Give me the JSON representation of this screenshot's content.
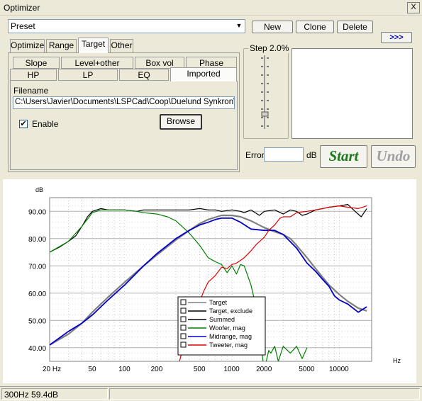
{
  "window": {
    "title": "Optimizer",
    "close_label": "X"
  },
  "toolbar": {
    "preset_value": "Preset",
    "new_label": "New",
    "clone_label": "Clone",
    "delete_label": "Delete",
    "more_label": ">>>"
  },
  "tabs": [
    {
      "label": "Optimize",
      "active": false
    },
    {
      "label": "Range",
      "active": false
    },
    {
      "label": "Target",
      "active": true
    },
    {
      "label": "Other",
      "active": false
    }
  ],
  "subtabs_row1": [
    "Slope",
    "Level+other",
    "Box vol",
    "Phase"
  ],
  "subtabs_row2": [
    "HP",
    "LP",
    "EQ",
    "Imported"
  ],
  "target_panel": {
    "filename_label": "Filename",
    "filename_value": "C:\\Users\\Javier\\Documents\\LSPCad\\Coop\\Duelund Synkron\\A",
    "enable_label": "Enable",
    "enable_checked": true,
    "browse_label": "Browse"
  },
  "step": {
    "label": "Step 2.0%"
  },
  "error": {
    "label": "Error",
    "unit": "dB",
    "value": ""
  },
  "actions": {
    "start_label": "Start",
    "undo_label": "Undo"
  },
  "status": {
    "readout": "300Hz 59.4dB",
    "second": ""
  },
  "colors": {
    "target": "#808080",
    "target_exclude": "#000000",
    "summed": "#000000",
    "woofer": "#008000",
    "midrange": "#0000c8",
    "tweeter": "#e00000",
    "start": "#1a7a1a",
    "undo": "#a0a0a0"
  },
  "chart_data": {
    "type": "line",
    "ylabel": "dB",
    "xlabel": "Hz",
    "xscale": "log",
    "xlim": [
      20,
      20000
    ],
    "ylim": [
      35,
      95
    ],
    "xticks": [
      {
        "v": 20,
        "label": "20 Hz"
      },
      {
        "v": 50,
        "label": "50"
      },
      {
        "v": 100,
        "label": "100"
      },
      {
        "v": 200,
        "label": "200"
      },
      {
        "v": 500,
        "label": "500"
      },
      {
        "v": 1000,
        "label": "1000"
      },
      {
        "v": 2000,
        "label": "2000"
      },
      {
        "v": 5000,
        "label": "5000"
      },
      {
        "v": 10000,
        "label": "10000"
      }
    ],
    "yticks": [
      {
        "v": 90,
        "label": "90.00"
      },
      {
        "v": 80,
        "label": "80.00"
      },
      {
        "v": 70,
        "label": "70.00"
      },
      {
        "v": 60,
        "label": "60.00"
      },
      {
        "v": 50,
        "label": "50.00"
      },
      {
        "v": 40,
        "label": "40.00"
      }
    ],
    "grid": true,
    "legend_position": "bottom-center",
    "series": [
      {
        "name": "Target",
        "color": "#808080",
        "width": 2.2,
        "x": [
          20,
          30,
          40,
          50,
          70,
          100,
          150,
          200,
          300,
          400,
          500,
          600,
          800,
          1000,
          1200,
          1500,
          2000,
          2500,
          3000,
          3500,
          4000,
          5000,
          6000,
          8000,
          10000,
          12000,
          15000,
          18000
        ],
        "y": [
          41,
          45,
          49,
          53,
          58.5,
          64,
          70,
          74,
          79.5,
          83,
          85.5,
          87,
          88.5,
          88.5,
          88,
          86.5,
          84,
          82.5,
          81.5,
          80,
          77.5,
          73,
          69,
          63,
          59.5,
          57,
          54.5,
          53.5
        ]
      },
      {
        "name": "Target, exclude",
        "color": "#000000",
        "width": 1.2,
        "x": [],
        "y": []
      },
      {
        "name": "Summed",
        "color": "#000000",
        "width": 1.2,
        "x": [
          20,
          25,
          30,
          35,
          40,
          45,
          50,
          60,
          70,
          80,
          100,
          130,
          150,
          200,
          250,
          300,
          400,
          500,
          600,
          700,
          800,
          1000,
          1200,
          1300,
          1500,
          1800,
          2000,
          2500,
          3000,
          3500,
          4000,
          4500,
          5000,
          6000,
          7000,
          8000,
          10000,
          12000,
          14000,
          16000,
          18000
        ],
        "y": [
          75,
          77,
          79,
          81,
          84.5,
          88,
          90,
          91,
          90.5,
          90.5,
          90.5,
          90,
          90.5,
          90.5,
          90.5,
          90.5,
          90.5,
          91,
          90.5,
          90.5,
          90,
          90.5,
          90,
          89.5,
          90.5,
          88.5,
          90,
          90.5,
          89,
          90.5,
          90,
          88.5,
          89,
          90.5,
          91,
          91.5,
          92,
          92.5,
          90,
          88,
          91
        ]
      },
      {
        "name": "Woofer, mag",
        "color": "#008000",
        "width": 1.2,
        "x": [
          20,
          30,
          40,
          50,
          60,
          70,
          100,
          130,
          150,
          200,
          250,
          300,
          400,
          500,
          600,
          700,
          800,
          900,
          1000,
          1100,
          1200,
          1300,
          1500,
          1700,
          1800,
          1900,
          2000,
          2200,
          2300,
          2500,
          2700,
          3000,
          3500,
          4000,
          4500,
          5000
        ],
        "y": [
          75,
          79,
          84.5,
          89.5,
          90.5,
          90.5,
          90.5,
          90,
          89.5,
          89,
          88,
          86.5,
          82,
          77.5,
          73,
          71.5,
          70.5,
          67.5,
          70,
          67,
          70.5,
          70,
          63,
          54,
          45.5,
          38,
          32,
          39,
          38,
          40.5,
          35,
          40.5,
          38,
          40.5,
          36,
          40
        ]
      },
      {
        "name": "Midrange, mag",
        "color": "#0000c8",
        "width": 1.8,
        "x": [
          20,
          30,
          40,
          50,
          70,
          100,
          150,
          200,
          300,
          400,
          500,
          600,
          700,
          800,
          1000,
          1200,
          1500,
          2000,
          2500,
          3000,
          4000,
          5000,
          6000,
          7000,
          8000,
          9000,
          10000,
          12000,
          15000,
          18000
        ],
        "y": [
          41,
          46,
          49,
          52,
          57.5,
          63,
          70,
          74.5,
          80,
          83,
          85,
          86,
          87,
          87.5,
          87.5,
          86,
          83.5,
          83,
          83,
          81.5,
          76.5,
          71,
          68,
          65,
          62.5,
          59,
          57.5,
          56,
          53,
          55
        ]
      },
      {
        "name": "Tweeter, mag",
        "color": "#e00000",
        "width": 1.2,
        "x": [
          300,
          350,
          400,
          450,
          500,
          550,
          600,
          700,
          800,
          900,
          1000,
          1100,
          1200,
          1300,
          1500,
          1700,
          2000,
          2200,
          2500,
          2800,
          3000,
          3500,
          4000,
          5000,
          6000,
          7000,
          8000,
          10000,
          12000,
          15000,
          18000
        ],
        "y": [
          30,
          40,
          45.5,
          52.5,
          57,
          61,
          64,
          66.5,
          69.5,
          69,
          70.5,
          71,
          72,
          73,
          75.5,
          78,
          80.5,
          83,
          85,
          87.5,
          88,
          88,
          89.5,
          90,
          90.5,
          91,
          91.5,
          92,
          91.5,
          91,
          92
        ]
      }
    ]
  }
}
